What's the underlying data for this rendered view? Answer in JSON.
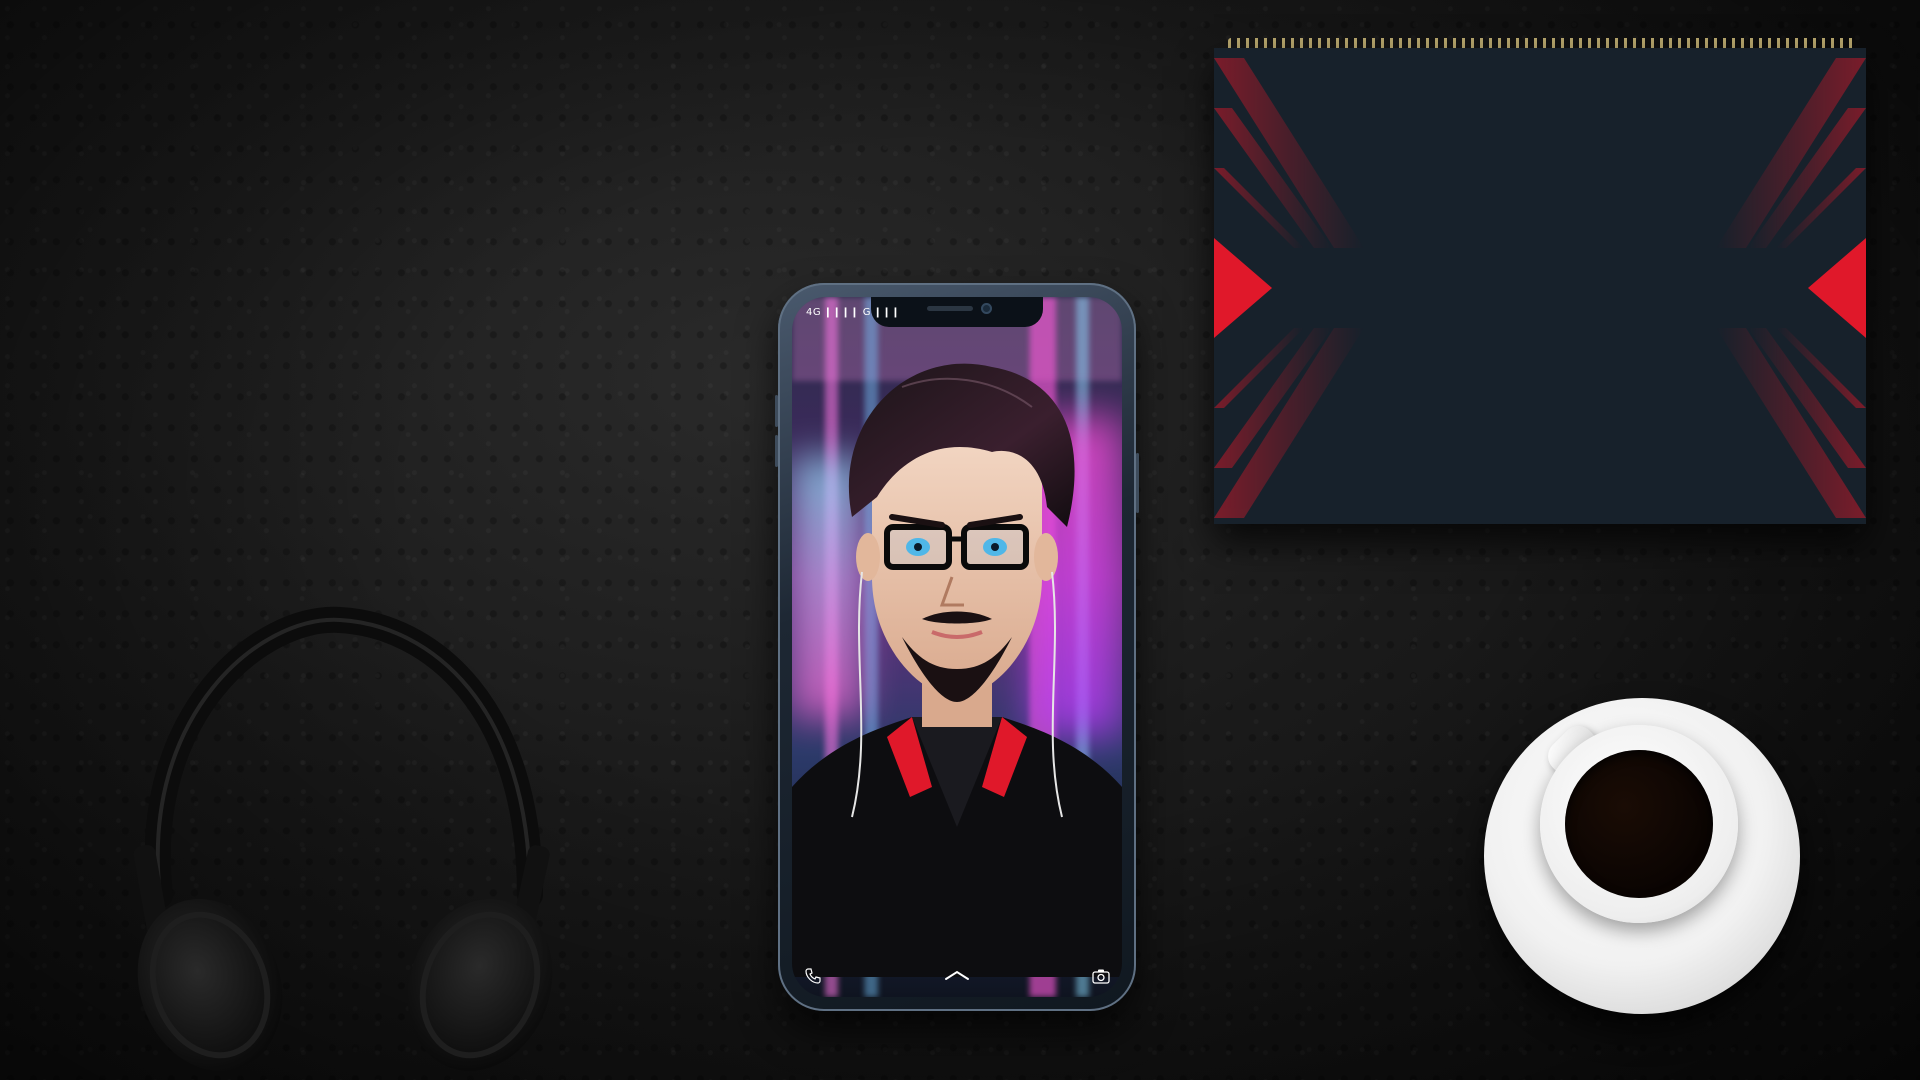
{
  "scene": {
    "description_items": [
      "leather-background",
      "smartphone",
      "notebook",
      "headphones",
      "coffee-cup"
    ]
  },
  "phone": {
    "status_bar": "4G ❙❙❙❙ G ❙❙❙",
    "bottom_icons": [
      "phone-icon",
      "home-chevron-icon",
      "camera-icon"
    ],
    "wallpaper": "anime-avatar-neon-city"
  },
  "notebook": {
    "colors": {
      "panel": "#17212b",
      "accent": "#e0182a"
    }
  },
  "colors": {
    "leather": "#1a1a1a",
    "neon_pink": "#ff4fd8",
    "neon_blue": "#8fe6ff"
  }
}
